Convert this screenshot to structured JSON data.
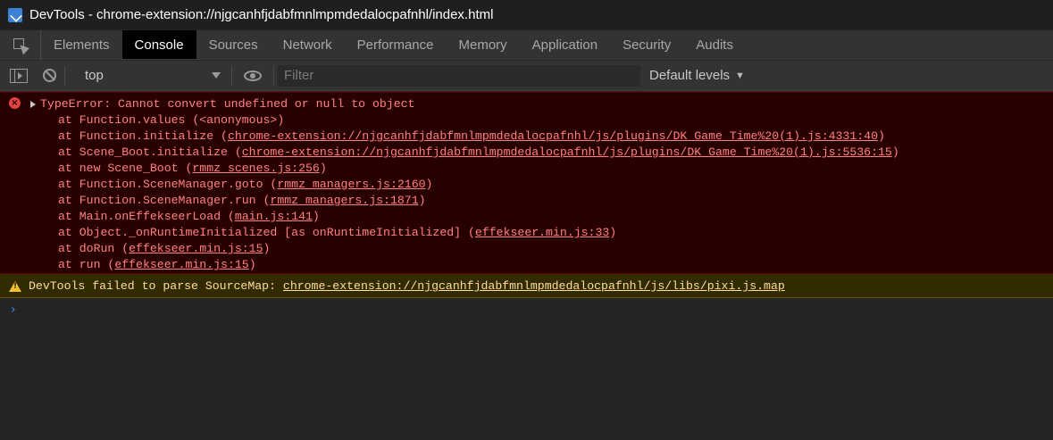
{
  "window": {
    "title": "DevTools - chrome-extension://njgcanhfjdabfmnlmpmdedalocpafnhl/index.html",
    "icon": "devtools-icon"
  },
  "tabs": [
    {
      "label": "Elements"
    },
    {
      "label": "Console",
      "active": true
    },
    {
      "label": "Sources"
    },
    {
      "label": "Network"
    },
    {
      "label": "Performance"
    },
    {
      "label": "Memory"
    },
    {
      "label": "Application"
    },
    {
      "label": "Security"
    },
    {
      "label": "Audits"
    }
  ],
  "toolbar": {
    "context": "top",
    "filter_placeholder": "Filter",
    "levels": "Default levels",
    "levels_caret": "▼"
  },
  "console": {
    "error": {
      "message": "TypeError: Cannot convert undefined or null to object",
      "stack": [
        {
          "prefix": "at Function.values (<anonymous>)",
          "link": "",
          "suffix": ""
        },
        {
          "prefix": "at Function.initialize (",
          "link": "chrome-extension://njgcanhfjdabfmnlmpmdedalocpafnhl/js/plugins/DK_Game_Time%20(1).js:4331:40",
          "suffix": ")"
        },
        {
          "prefix": "at Scene_Boot.initialize (",
          "link": "chrome-extension://njgcanhfjdabfmnlmpmdedalocpafnhl/js/plugins/DK_Game_Time%20(1).js:5536:15",
          "suffix": ")"
        },
        {
          "prefix": "at new Scene_Boot (",
          "link": "rmmz_scenes.js:256",
          "suffix": ")"
        },
        {
          "prefix": "at Function.SceneManager.goto (",
          "link": "rmmz_managers.js:2160",
          "suffix": ")"
        },
        {
          "prefix": "at Function.SceneManager.run (",
          "link": "rmmz_managers.js:1871",
          "suffix": ")"
        },
        {
          "prefix": "at Main.onEffekseerLoad (",
          "link": "main.js:141",
          "suffix": ")"
        },
        {
          "prefix": "at Object._onRuntimeInitialized [as onRuntimeInitialized] (",
          "link": "effekseer.min.js:33",
          "suffix": ")"
        },
        {
          "prefix": "at doRun (",
          "link": "effekseer.min.js:15",
          "suffix": ")"
        },
        {
          "prefix": "at run (",
          "link": "effekseer.min.js:15",
          "suffix": ")"
        }
      ]
    },
    "warning": {
      "message": "DevTools failed to parse SourceMap: ",
      "link": "chrome-extension://njgcanhfjdabfmnlmpmdedalocpafnhl/js/libs/pixi.js.map"
    },
    "prompt_symbol": "›"
  },
  "colors": {
    "error_bg": "#290000",
    "error_text": "#ff8080",
    "warning_bg": "#332b00",
    "warning_text": "#ffdd9e",
    "prompt": "#3d8be0"
  }
}
